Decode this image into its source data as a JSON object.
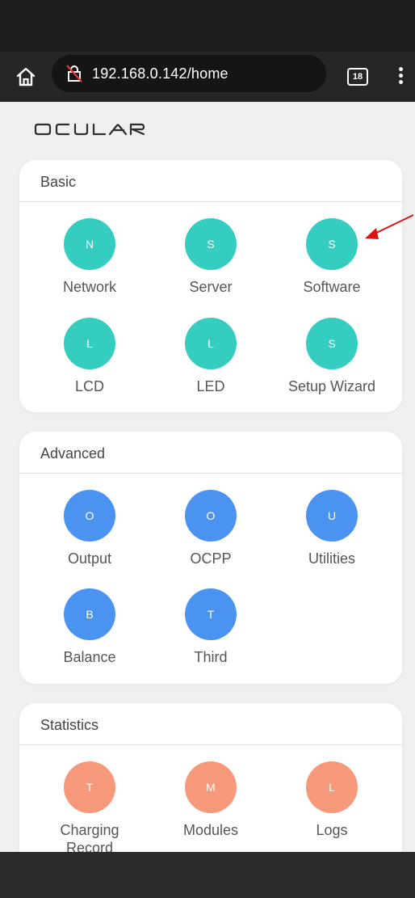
{
  "browser": {
    "url": "192.168.0.142/home",
    "tab_count": "18"
  },
  "brand": {
    "logo_text": "OCULAR"
  },
  "colors": {
    "basic": "#35cdbf",
    "advanced": "#4b93f1",
    "statistics": "#f6987a",
    "annotation_arrow": "#e01010"
  },
  "sections": {
    "basic": {
      "title": "Basic",
      "items": [
        {
          "letter": "N",
          "label": "Network"
        },
        {
          "letter": "S",
          "label": "Server"
        },
        {
          "letter": "S",
          "label": "Software"
        },
        {
          "letter": "L",
          "label": "LCD"
        },
        {
          "letter": "L",
          "label": "LED"
        },
        {
          "letter": "S",
          "label": "Setup Wizard"
        }
      ]
    },
    "advanced": {
      "title": "Advanced",
      "items": [
        {
          "letter": "O",
          "label": "Output"
        },
        {
          "letter": "O",
          "label": "OCPP"
        },
        {
          "letter": "U",
          "label": "Utilities"
        },
        {
          "letter": "B",
          "label": "Balance"
        },
        {
          "letter": "T",
          "label": "Third"
        }
      ]
    },
    "statistics": {
      "title": "Statistics",
      "items": [
        {
          "letter": "T",
          "label": "Charging Record"
        },
        {
          "letter": "M",
          "label": "Modules"
        },
        {
          "letter": "L",
          "label": "Logs"
        }
      ]
    }
  }
}
